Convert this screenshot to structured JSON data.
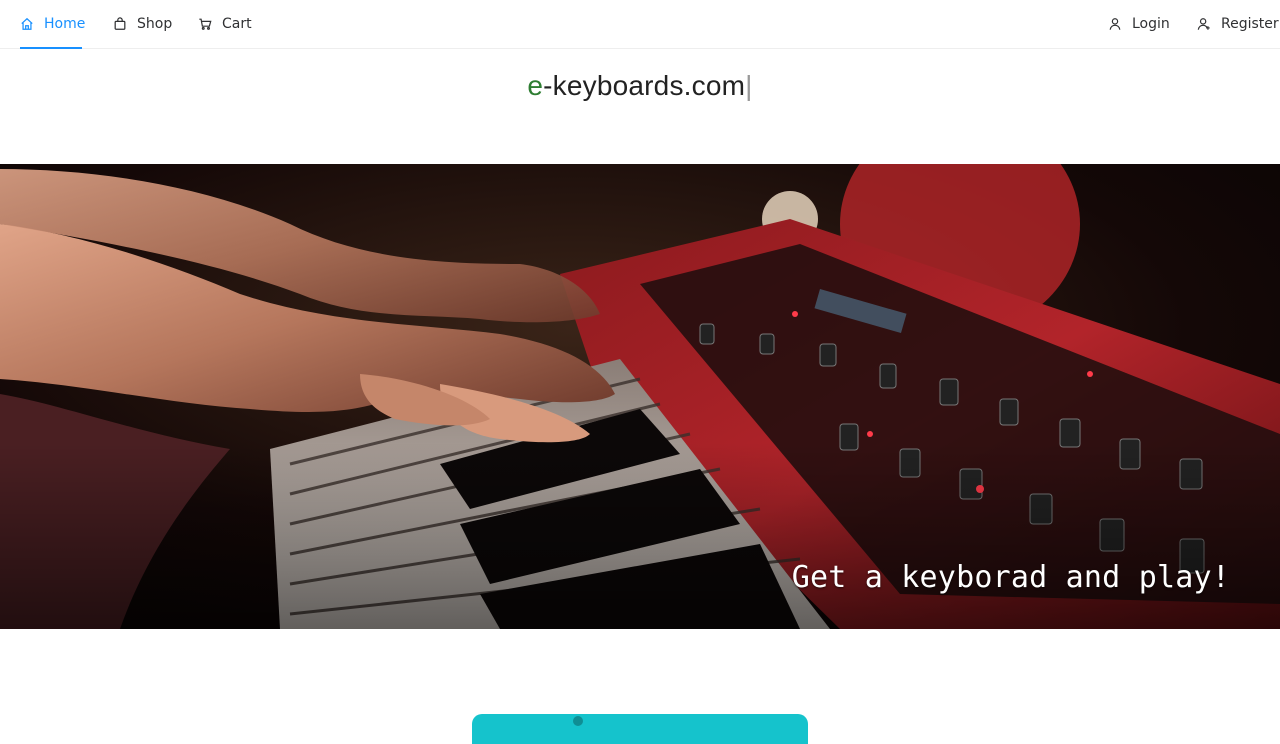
{
  "nav": {
    "left": [
      {
        "label": "Home",
        "icon": "home-icon",
        "active": true
      },
      {
        "label": "Shop",
        "icon": "shopping-bag-icon",
        "active": false
      },
      {
        "label": "Cart",
        "icon": "cart-icon",
        "active": false
      }
    ],
    "right": [
      {
        "label": "Login",
        "icon": "user-icon"
      },
      {
        "label": "Register",
        "icon": "user-add-icon"
      }
    ],
    "active_color": "#1890ff"
  },
  "brand": {
    "prefix": "e",
    "rest": "-keyboards.com",
    "caret": "|",
    "prefix_color": "#2e7d32"
  },
  "hero": {
    "tagline": "Get a keyborad and play!",
    "image": "hands-playing-red-keyboard-image"
  },
  "cta": {
    "color": "#15c3cc"
  }
}
